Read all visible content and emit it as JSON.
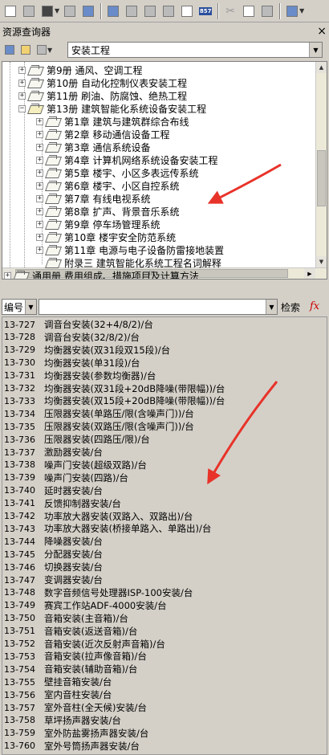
{
  "panel": {
    "title": "资源查询器",
    "close": "×"
  },
  "combo": {
    "value": "安装工程"
  },
  "tree": {
    "nodes": [
      {
        "label": "第9册    通风、空调工程",
        "level": 1,
        "expand": "+",
        "open": false
      },
      {
        "label": "第10册   自动化控制仪表安装工程",
        "level": 1,
        "expand": "+",
        "open": false
      },
      {
        "label": "第11册   刷油、防腐蚀、绝热工程",
        "level": 1,
        "expand": "+",
        "open": false
      },
      {
        "label": "第13册   建筑智能化系统设备安装工程",
        "level": 1,
        "expand": "−",
        "open": true
      },
      {
        "label": "第1章   建筑与建筑群综合布线",
        "level": 2,
        "expand": "+",
        "open": false
      },
      {
        "label": "第2章   移动通信设备工程",
        "level": 2,
        "expand": "+",
        "open": false
      },
      {
        "label": "第3章   通信系统设备",
        "level": 2,
        "expand": "+",
        "open": false
      },
      {
        "label": "第4章   计算机网络系统设备安装工程",
        "level": 2,
        "expand": "+",
        "open": false
      },
      {
        "label": "第5章   楼宇、小区多表远传系统",
        "level": 2,
        "expand": "+",
        "open": false
      },
      {
        "label": "第6章   楼宇、小区自控系统",
        "level": 2,
        "expand": "+",
        "open": false
      },
      {
        "label": "第7章   有线电视系统",
        "level": 2,
        "expand": "+",
        "open": false
      },
      {
        "label": "第8章   扩声、背景音乐系统",
        "level": 2,
        "expand": "+",
        "open": false
      },
      {
        "label": "第9章   停车场管理系统",
        "level": 2,
        "expand": "+",
        "open": false
      },
      {
        "label": "第10章   楼宇安全防范系统",
        "level": 2,
        "expand": "+",
        "open": false
      },
      {
        "label": "第11章   电源与电子设备防雷接地装置",
        "level": 2,
        "expand": "+",
        "open": false
      },
      {
        "label": "附录三   建筑智能化系统工程名词解释",
        "level": 2,
        "expand": "",
        "open": false
      },
      {
        "label": "通用册   费用组成、措施项目及计算方法",
        "level": 0,
        "expand": "+",
        "open": false
      }
    ],
    "hscroll_grip": "III"
  },
  "search": {
    "field": "编号",
    "button": "检索",
    "fx": "fx"
  },
  "list": [
    {
      "code": "13-727",
      "name": "调音台安装(32+4/8/2)/台"
    },
    {
      "code": "13-728",
      "name": "调音台安装(32/8/2)/台"
    },
    {
      "code": "13-729",
      "name": "均衡器安装(双31段双15段)/台"
    },
    {
      "code": "13-730",
      "name": "均衡器安装(单31段)/台"
    },
    {
      "code": "13-731",
      "name": "均衡器安装(参数均衡器)/台"
    },
    {
      "code": "13-732",
      "name": "均衡器安装(双31段+20dB降噪(带限幅))/台"
    },
    {
      "code": "13-733",
      "name": "均衡器安装(双15段+20dB降噪(带限幅))/台"
    },
    {
      "code": "13-734",
      "name": "压限器安装(单路压/限(含噪声门))/台"
    },
    {
      "code": "13-735",
      "name": "压限器安装(双路压/限(含噪声门))/台"
    },
    {
      "code": "13-736",
      "name": "压限器安装(四路压/限)/台"
    },
    {
      "code": "13-737",
      "name": "激励器安装/台"
    },
    {
      "code": "13-738",
      "name": "噪声门安装(超级双路)/台"
    },
    {
      "code": "13-739",
      "name": "噪声门安装(四路)/台"
    },
    {
      "code": "13-740",
      "name": "延时器安装/台"
    },
    {
      "code": "13-741",
      "name": "反馈抑制器安装/台"
    },
    {
      "code": "13-742",
      "name": "功率放大器安装(双路入、双路出)/台"
    },
    {
      "code": "13-743",
      "name": "功率放大器安装(桥接单路入、单路出)/台"
    },
    {
      "code": "13-744",
      "name": "降噪器安装/台"
    },
    {
      "code": "13-745",
      "name": "分配器安装/台"
    },
    {
      "code": "13-746",
      "name": "切换器安装/台"
    },
    {
      "code": "13-747",
      "name": "变调器安装/台"
    },
    {
      "code": "13-748",
      "name": "数字音频信号处理器ISP-100安装/台"
    },
    {
      "code": "13-749",
      "name": "赛宾工作站ADF-4000安装/台"
    },
    {
      "code": "13-750",
      "name": "音箱安装(主音箱)/台"
    },
    {
      "code": "13-751",
      "name": "音箱安装(返送音箱)/台"
    },
    {
      "code": "13-752",
      "name": "音箱安装(近次反射声音箱)/台"
    },
    {
      "code": "13-753",
      "name": "音箱安装(拉声像音箱)/台"
    },
    {
      "code": "13-754",
      "name": "音箱安装(辅助音箱)/台"
    },
    {
      "code": "13-755",
      "name": "壁挂音箱安装/台"
    },
    {
      "code": "13-756",
      "name": "室内音柱安装/台"
    },
    {
      "code": "13-757",
      "name": "室外音柱(全天候)安装/台"
    },
    {
      "code": "13-758",
      "name": "草坪扬声器安装/台"
    },
    {
      "code": "13-759",
      "name": "室外防盐雾扬声器安装/台"
    },
    {
      "code": "13-760",
      "name": "室外号筒扬声器安装/台"
    }
  ],
  "toolbar": {
    "icons": [
      "new-file-icon",
      "open-folder-icon",
      "save-icon",
      "print-icon",
      "insert-icon",
      "grid-icon",
      "grid-icon",
      "grid-icon",
      "grid-icon",
      "check-icon",
      "calc-icon",
      "cut-icon",
      "copy-icon",
      "paste-icon",
      "program-icon"
    ],
    "calc_label": "857"
  },
  "colors": {
    "annotation_arrow": "#e8332a"
  }
}
